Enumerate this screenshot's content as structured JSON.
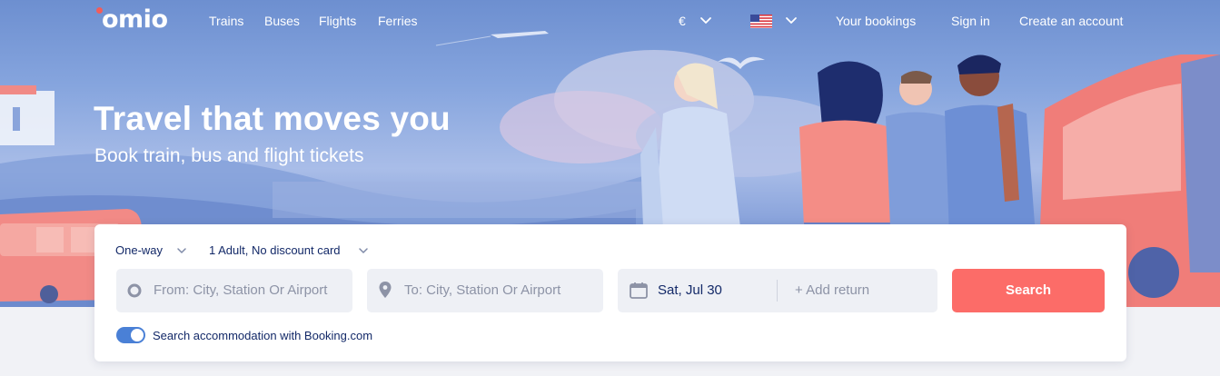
{
  "brand": {
    "logo_text": "omio",
    "accent": "#f25d5b"
  },
  "nav": {
    "links": [
      "Trains",
      "Buses",
      "Flights",
      "Ferries"
    ],
    "currency": "€",
    "country_flag": "us-flag-icon",
    "your_bookings": "Your bookings",
    "sign_in": "Sign in",
    "create_account": "Create an account"
  },
  "hero": {
    "title": "Travel that moves you",
    "subtitle": "Book train, bus and flight tickets"
  },
  "search": {
    "trip_type": "One-way",
    "passengers": "1 Adult, No discount card",
    "from_placeholder": "From: City, Station Or Airport",
    "to_placeholder": "To: City, Station Or Airport",
    "date": "Sat, Jul 30",
    "add_return": "+ Add return",
    "button_label": "Search",
    "button_color": "#fc6c68",
    "booking_toggle": {
      "label": "Search accommodation with Booking.com",
      "on": true
    }
  }
}
